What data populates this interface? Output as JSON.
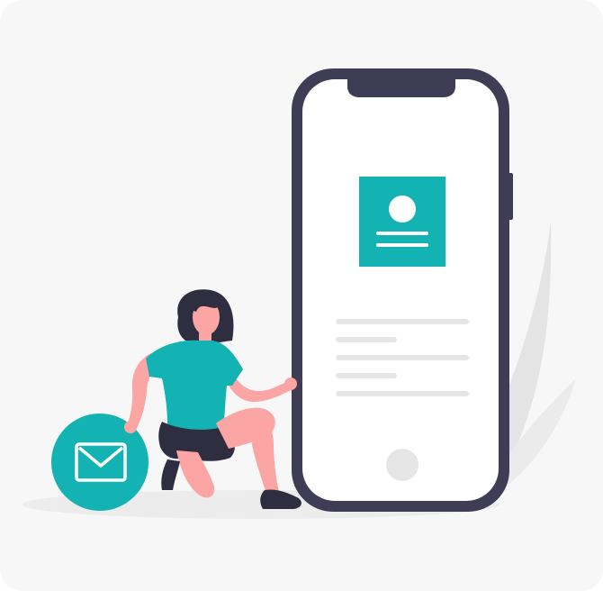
{
  "illustration": {
    "subject": "woman-kneeling-beside-smartphone",
    "icons": [
      "envelope-icon",
      "profile-card-icon",
      "home-button-icon"
    ]
  },
  "colors": {
    "background": "#f7f7f8",
    "accent": "#14b3b3",
    "phone_frame": "#3f3d56",
    "screen": "#ffffff",
    "text_placeholder": "#e6e6e6",
    "skin": "#fca5a5",
    "hair": "#2f2e41",
    "shorts": "#2f2e41",
    "leaf": "#e3e3e3"
  }
}
